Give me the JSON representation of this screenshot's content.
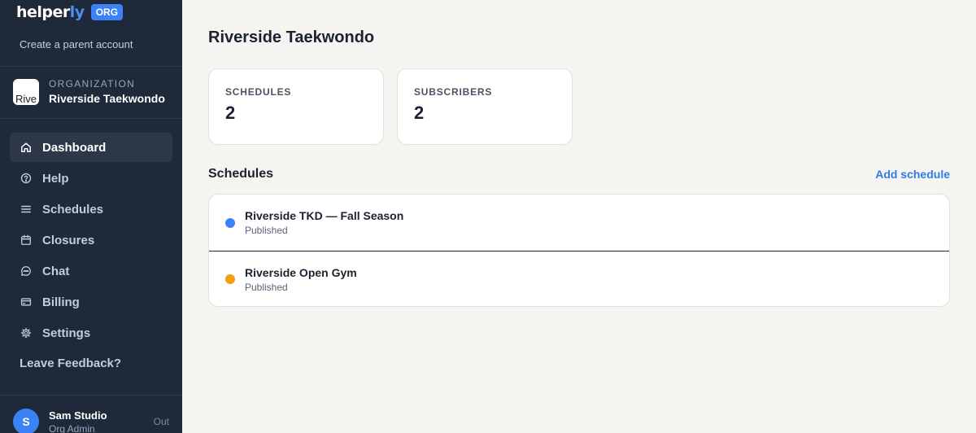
{
  "brand": {
    "logo_main": "helper",
    "logo_accent": "ly",
    "badge": "ORG"
  },
  "sidebar": {
    "create_parent": "Create a parent account",
    "org": {
      "label": "ORGANIZATION",
      "name": "Riverside Taekwondo",
      "avatar_alt": "Rive"
    },
    "items": [
      {
        "label": "Dashboard",
        "icon": "home-icon",
        "active": true
      },
      {
        "label": "Help",
        "icon": "help-icon"
      },
      {
        "label": "Schedules",
        "icon": "list-icon"
      },
      {
        "label": "Closures",
        "icon": "calendar-icon"
      },
      {
        "label": "Chat",
        "icon": "chat-icon"
      },
      {
        "label": "Billing",
        "icon": "credit-card-icon"
      },
      {
        "label": "Settings",
        "icon": "gear-icon"
      }
    ],
    "feedback": "Leave Feedback?",
    "user": {
      "initial": "S",
      "name": "Sam Studio",
      "role": "Org Admin",
      "logout": "Out"
    }
  },
  "main": {
    "title": "Riverside Taekwondo",
    "stats": [
      {
        "label": "SCHEDULES",
        "value": "2"
      },
      {
        "label": "SUBSCRIBERS",
        "value": "2"
      }
    ],
    "section_title": "Schedules",
    "add_label": "Add schedule",
    "schedules": [
      {
        "name": "Riverside TKD — Fall Season",
        "status": "Published",
        "color": "#3b82f6"
      },
      {
        "name": "Riverside Open Gym",
        "status": "Published",
        "color": "#f59e0b"
      }
    ]
  },
  "colors": {
    "sidebar_bg": "#1e2a3a",
    "accent": "#3b82f6",
    "link": "#2f7de1",
    "page_bg": "#f5f4f1"
  }
}
